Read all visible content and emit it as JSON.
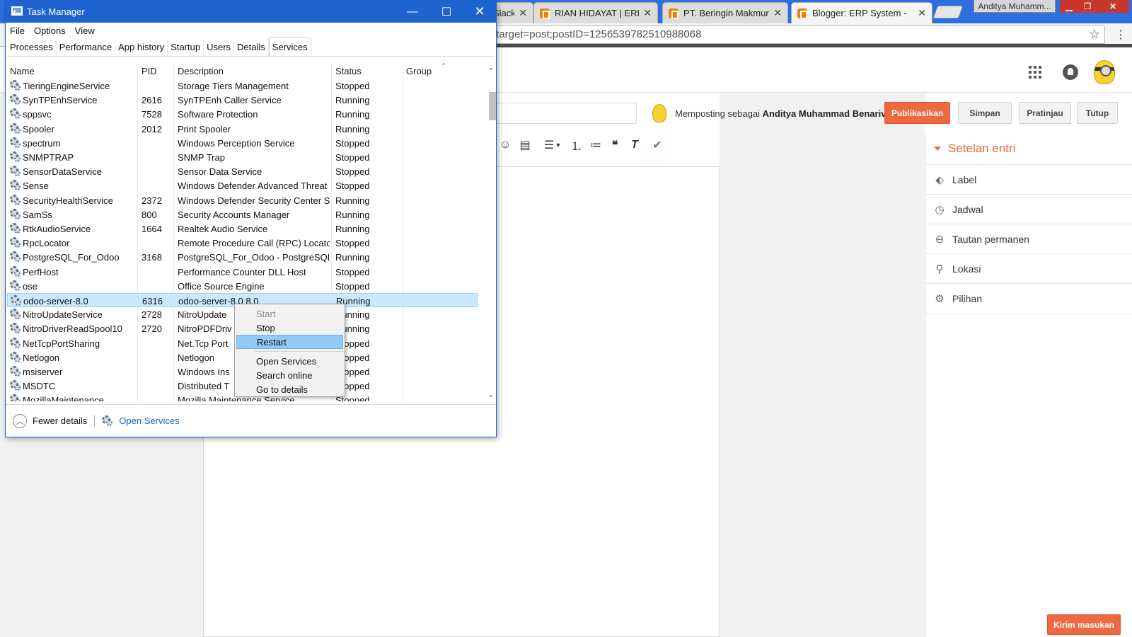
{
  "browser": {
    "tabs": [
      {
        "title": "Slack",
        "favicon": false
      },
      {
        "title": "RIAN HIDAYAT | ERP B",
        "favicon": true
      },
      {
        "title": "PT. Beringin Makmur S",
        "favicon": true
      },
      {
        "title": "Blogger: ERP System -",
        "favicon": true,
        "active": true
      }
    ],
    "profile_name": "Anditya Muhamm...",
    "url": "/target=post;postID=1256539782510988068",
    "close_glyph": "✕",
    "min_glyph": "▁",
    "max_glyph": "❐"
  },
  "blogger": {
    "posting_as_prefix": "Memposting sebagai",
    "posting_as_name": "Anditya Muhammad Benarivo",
    "buttons": {
      "publish": "Publikasikan",
      "save": "Simpan",
      "preview": "Pratinjau",
      "close": "Tutup"
    },
    "settings_title": "Setelan entri",
    "settings_items": [
      {
        "label": "Label",
        "icon": "tag-icon"
      },
      {
        "label": "Jadwal",
        "icon": "clock-icon"
      },
      {
        "label": "Tautan permanen",
        "icon": "link-icon"
      },
      {
        "label": "Lokasi",
        "icon": "location-icon"
      },
      {
        "label": "Pilihan",
        "icon": "gear-icon"
      }
    ],
    "feedback_button": "Kirim masukan",
    "accent_color": "#f0683f"
  },
  "taskmgr": {
    "title": "Task Manager",
    "menu": [
      "File",
      "Options",
      "View"
    ],
    "tabs": [
      "Processes",
      "Performance",
      "App history",
      "Startup",
      "Users",
      "Details",
      "Services"
    ],
    "active_tab": "Services",
    "columns": {
      "name": "Name",
      "pid": "PID",
      "description": "Description",
      "status": "Status",
      "group": "Group"
    },
    "rows": [
      {
        "name": "TieringEngineService",
        "pid": "",
        "description": "Storage Tiers Management",
        "status": "Stopped"
      },
      {
        "name": "SynTPEnhService",
        "pid": "2616",
        "description": "SynTPEnh Caller Service",
        "status": "Running"
      },
      {
        "name": "sppsvc",
        "pid": "7528",
        "description": "Software Protection",
        "status": "Running"
      },
      {
        "name": "Spooler",
        "pid": "2012",
        "description": "Print Spooler",
        "status": "Running"
      },
      {
        "name": "spectrum",
        "pid": "",
        "description": "Windows Perception Service",
        "status": "Stopped"
      },
      {
        "name": "SNMPTRAP",
        "pid": "",
        "description": "SNMP Trap",
        "status": "Stopped"
      },
      {
        "name": "SensorDataService",
        "pid": "",
        "description": "Sensor Data Service",
        "status": "Stopped"
      },
      {
        "name": "Sense",
        "pid": "",
        "description": "Windows Defender Advanced Threat ...",
        "status": "Stopped"
      },
      {
        "name": "SecurityHealthService",
        "pid": "2372",
        "description": "Windows Defender Security Center Se...",
        "status": "Running"
      },
      {
        "name": "SamSs",
        "pid": "800",
        "description": "Security Accounts Manager",
        "status": "Running"
      },
      {
        "name": "RtkAudioService",
        "pid": "1664",
        "description": "Realtek Audio Service",
        "status": "Running"
      },
      {
        "name": "RpcLocator",
        "pid": "",
        "description": "Remote Procedure Call (RPC) Locator",
        "status": "Stopped"
      },
      {
        "name": "PostgreSQL_For_Odoo",
        "pid": "3168",
        "description": "PostgreSQL_For_Odoo - PostgreSQL S...",
        "status": "Running"
      },
      {
        "name": "PerfHost",
        "pid": "",
        "description": "Performance Counter DLL Host",
        "status": "Stopped"
      },
      {
        "name": "ose",
        "pid": "",
        "description": "Office  Source Engine",
        "status": "Stopped"
      },
      {
        "name": "odoo-server-8.0",
        "pid": "6316",
        "description": "odoo-server-8.0 8.0",
        "status": "Running",
        "selected": true
      },
      {
        "name": "NitroUpdateService",
        "pid": "2728",
        "description": "NitroUpdate",
        "status": "Running"
      },
      {
        "name": "NitroDriverReadSpool10",
        "pid": "2720",
        "description": "NitroPDFDriv",
        "status": "Running"
      },
      {
        "name": "NetTcpPortSharing",
        "pid": "",
        "description": "Net.Tcp Port",
        "status": "Stopped"
      },
      {
        "name": "Netlogon",
        "pid": "",
        "description": "Netlogon",
        "status": "Stopped"
      },
      {
        "name": "msiserver",
        "pid": "",
        "description": "Windows Ins",
        "status": "Stopped"
      },
      {
        "name": "MSDTC",
        "pid": "",
        "description": "Distributed T",
        "status": "Stopped"
      },
      {
        "name": "MozillaMaintenance",
        "pid": "",
        "description": "Mozilla Maintenance Service",
        "status": "Stopped"
      }
    ],
    "context_menu": {
      "start": "Start",
      "stop": "Stop",
      "restart": "Restart",
      "open_services": "Open Services",
      "search_online": "Search online",
      "go_to_details": "Go to details"
    },
    "footer": {
      "fewer_details": "Fewer details",
      "open_services": "Open Services"
    },
    "title_color": "#1e63cf"
  }
}
